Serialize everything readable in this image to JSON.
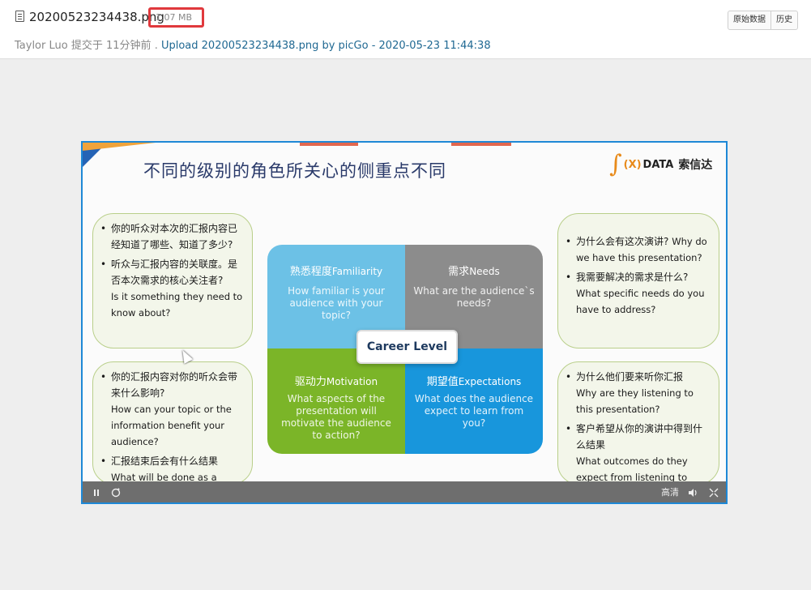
{
  "header": {
    "file_name": "20200523234438.png",
    "file_size": "1.07 MB",
    "author": "Taylor Luo",
    "committed_label": "提交于",
    "time_ago": "11分钟前",
    "separator": ".",
    "commit_message": "Upload 20200523234438.png by picGo - 2020-05-23 11:44:38",
    "raw_button": "原始数据",
    "history_button": "历史"
  },
  "slide": {
    "title": "不同的级别的角色所关心的侧重点不同",
    "logo": {
      "mark": "∫",
      "x": "(X)",
      "data": "DATA",
      "cn": "索信达"
    },
    "top_left_bubble": [
      "你的听众对本次的汇报内容已经知道了哪些、知道了多少?",
      "听众与汇报内容的关联度。是否本次需求的核心关注者?",
      "Is it something they need to know about?"
    ],
    "bottom_left_bubble": [
      "你的汇报内容对你的听众会带来什么影响?",
      "How can your topic or the information benefit your audience?",
      "汇报结束后会有什么结果",
      "What will be done as a result of this presentation?"
    ],
    "top_right_bubble": [
      "为什么会有这次演讲?",
      "Why do we have this presentation?",
      "我需要解决的需求是什么?",
      "What specific needs do you have to address?"
    ],
    "bottom_right_bubble": [
      "为什么他们要来听你汇报",
      "Why are they listening to this presentation?",
      "客户希望从你的演讲中得到什么结果",
      "What outcomes do they expect from listening to your presentation?"
    ],
    "quadrants": {
      "familiarity": {
        "cn": "熟悉程度",
        "en": "Familiarity",
        "body": "How familiar is your audience with your topic?",
        "color": "#6cc1e6"
      },
      "needs": {
        "cn": "需求",
        "en": "Needs",
        "body": "What are the audience`s needs?",
        "color": "#8c8c8c"
      },
      "motivation": {
        "cn": "驱动力",
        "en": "Motivation",
        "body": "What aspects of the presentation will motivate the audience to action?",
        "color": "#7bb528"
      },
      "expectations": {
        "cn": "期望值",
        "en": "Expectations",
        "body": "What does the audience expect to learn from you?",
        "color": "#1896dc"
      }
    },
    "center_label": "Career Level"
  },
  "player": {
    "pause_icon": "pause-icon",
    "loop_icon": "loop-icon",
    "quality_label": "高清",
    "volume_icon": "volume-icon",
    "fullscreen_icon": "fullscreen-icon"
  }
}
